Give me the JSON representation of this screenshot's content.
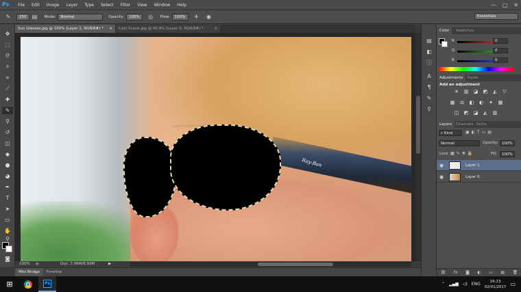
{
  "menubar": {
    "logo": "Ps",
    "items": [
      "File",
      "Edit",
      "Image",
      "Layer",
      "Type",
      "Select",
      "Filter",
      "View",
      "Window",
      "Help"
    ],
    "window_controls": [
      "—",
      "▢",
      "✕"
    ]
  },
  "options": {
    "brush_size": "250",
    "mode_label": "Mode:",
    "mode_value": "Normal",
    "opacity_label": "Opacity:",
    "opacity_value": "100%",
    "flow_label": "Flow:",
    "flow_value": "100%",
    "workspace": "Essentials"
  },
  "tabs": [
    {
      "label": "Sun Glasses.jpg @ 100% (Layer 1, RGB/8#) *",
      "close": "×"
    },
    {
      "label": "Cool Scene.jpg @ 40.9% (Layer 0, RGB/8#) *",
      "close": "×"
    }
  ],
  "canvas": {
    "watermark": "Ray-Ban"
  },
  "status": {
    "zoom": "100%",
    "doc": "Doc: 7.06M/8.93M",
    "arrow": "▶"
  },
  "bottom_tabs": [
    "Mini Bridge",
    "Timeline"
  ],
  "color_panel": {
    "tabs": [
      "Color",
      "Swatches"
    ],
    "channels": [
      {
        "label": "R",
        "value": "0",
        "color": "#e03030"
      },
      {
        "label": "G",
        "value": "0",
        "color": "#30c030"
      },
      {
        "label": "B",
        "value": "0",
        "color": "#3040e0"
      }
    ]
  },
  "adjustments_panel": {
    "tabs": [
      "Adjustments",
      "Styles"
    ],
    "heading": "Add an adjustment",
    "icons_row1": [
      "☀",
      "▥",
      "◪",
      "◩",
      "◭",
      "▽"
    ],
    "icons_row2": [
      "▦",
      "⚖",
      "◧",
      "◐",
      "✦",
      "▦"
    ],
    "icons_row3": [
      "◫",
      "◩",
      "◪",
      "◭",
      "▥"
    ]
  },
  "layers_panel": {
    "tabs": [
      "Layers",
      "Channels",
      "Paths"
    ],
    "filter_label": "Kind",
    "blend_mode": "Normal",
    "opacity_label": "Opacity:",
    "opacity_value": "100%",
    "lock_label": "Lock:",
    "fill_label": "Fill:",
    "fill_value": "100%",
    "layers": [
      {
        "name": "Layer 1",
        "selected": true
      },
      {
        "name": "Layer 0",
        "selected": false
      }
    ],
    "footer_icons": [
      "⛓",
      "fx",
      "◙",
      "◐",
      "▭",
      "▤",
      "🗑"
    ]
  },
  "taskbar": {
    "start": "⊞",
    "apps": [
      "chrome-icon",
      "photoshop-icon"
    ],
    "ps_label": "Ps",
    "language": "ENG",
    "time": "16:23",
    "date": "02/01/2017"
  }
}
